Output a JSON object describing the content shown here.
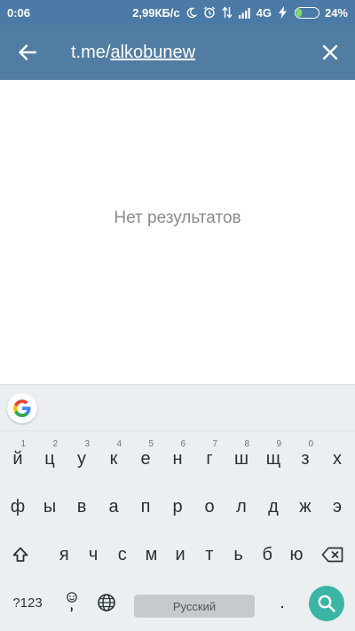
{
  "status_bar": {
    "time": "0:06",
    "speed": "2,99КБ/с",
    "network": "4G",
    "battery_percent": "24%",
    "battery_level": 0.24,
    "icons": [
      "moon-icon",
      "alarm-icon",
      "data-transfer-icon",
      "signal-icon",
      "charging-icon"
    ]
  },
  "app_bar": {
    "back_icon": "arrow-left-icon",
    "query_prefix": "t.me/",
    "query_link": "alkobunew",
    "close_icon": "close-icon"
  },
  "results": {
    "empty_text": "Нет результатов"
  },
  "keyboard": {
    "suggestion_icon": "google-icon",
    "row1": [
      {
        "key": "й",
        "hint": "1"
      },
      {
        "key": "ц",
        "hint": "2"
      },
      {
        "key": "у",
        "hint": "3"
      },
      {
        "key": "к",
        "hint": "4"
      },
      {
        "key": "е",
        "hint": "5"
      },
      {
        "key": "н",
        "hint": "6"
      },
      {
        "key": "г",
        "hint": "7"
      },
      {
        "key": "ш",
        "hint": "8"
      },
      {
        "key": "щ",
        "hint": "9"
      },
      {
        "key": "з",
        "hint": "0"
      },
      {
        "key": "х",
        "hint": ""
      }
    ],
    "row2": [
      "ф",
      "ы",
      "в",
      "а",
      "п",
      "р",
      "о",
      "л",
      "д",
      "ж",
      "э"
    ],
    "row3": [
      "я",
      "ч",
      "с",
      "м",
      "и",
      "т",
      "ь",
      "б",
      "ю"
    ],
    "symbols_label": "?123",
    "space_label": "Русский",
    "period_label": ".",
    "colors": {
      "accent": "#3bb5a4",
      "app_bar": "#527da3",
      "status_bar": "#4a7aa5"
    }
  }
}
